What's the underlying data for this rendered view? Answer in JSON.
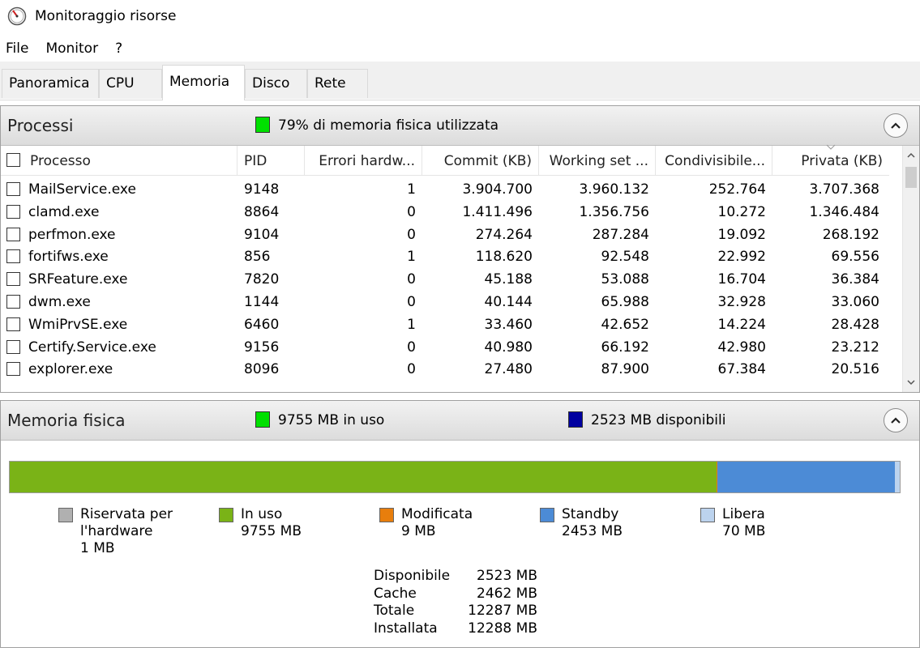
{
  "window": {
    "title": "Monitoraggio risorse"
  },
  "menu": [
    {
      "label": "File"
    },
    {
      "label": "Monitor"
    },
    {
      "label": "?"
    }
  ],
  "tabs": [
    {
      "label": "Panoramica",
      "active": false
    },
    {
      "label": "CPU",
      "active": false
    },
    {
      "label": "Memoria",
      "active": true
    },
    {
      "label": "Disco",
      "active": false
    },
    {
      "label": "Rete",
      "active": false
    }
  ],
  "processes": {
    "title": "Processi",
    "status_text": "79% di memoria fisica utilizzata",
    "status_color": "#00e000",
    "columns": [
      "Processo",
      "PID",
      "Errori hardw...",
      "Commit (KB)",
      "Working set ...",
      "Condivisibile...",
      "Privata (KB)"
    ],
    "rows": [
      [
        "MailService.exe",
        "9148",
        "1",
        "3.904.700",
        "3.960.132",
        "252.764",
        "3.707.368"
      ],
      [
        "clamd.exe",
        "8864",
        "0",
        "1.411.496",
        "1.356.756",
        "10.272",
        "1.346.484"
      ],
      [
        "perfmon.exe",
        "9104",
        "0",
        "274.264",
        "287.284",
        "19.092",
        "268.192"
      ],
      [
        "fortifws.exe",
        "856",
        "1",
        "118.620",
        "92.548",
        "22.992",
        "69.556"
      ],
      [
        "SRFeature.exe",
        "7820",
        "0",
        "45.188",
        "53.088",
        "16.704",
        "36.384"
      ],
      [
        "dwm.exe",
        "1144",
        "0",
        "40.144",
        "65.988",
        "32.928",
        "33.060"
      ],
      [
        "WmiPrvSE.exe",
        "6460",
        "1",
        "33.460",
        "42.652",
        "14.224",
        "28.428"
      ],
      [
        "Certify.Service.exe",
        "9156",
        "0",
        "40.980",
        "66.192",
        "42.980",
        "23.212"
      ],
      [
        "explorer.exe",
        "8096",
        "0",
        "27.480",
        "87.900",
        "67.384",
        "20.516"
      ]
    ]
  },
  "physical_memory": {
    "title": "Memoria fisica",
    "in_use_text": "9755 MB in uso",
    "in_use_color": "#00e000",
    "available_text": "2523 MB disponibili",
    "available_color": "#0000a0",
    "bar": [
      {
        "name": "reserved",
        "value": 1,
        "color": "#b0b0b0"
      },
      {
        "name": "in-use",
        "value": 9755,
        "color": "#7ab317"
      },
      {
        "name": "modified",
        "value": 9,
        "color": "#e87e0c"
      },
      {
        "name": "standby",
        "value": 2453,
        "color": "#4c8bd6"
      },
      {
        "name": "free",
        "value": 70,
        "color": "#bcd3ee"
      }
    ],
    "legend": [
      {
        "lines": [
          "Riservata per",
          "l'hardware",
          "1 MB"
        ],
        "color": "#b0b0b0"
      },
      {
        "lines": [
          "In uso",
          "9755 MB"
        ],
        "color": "#7ab317"
      },
      {
        "lines": [
          "Modificata",
          "9 MB"
        ],
        "color": "#e87e0c"
      },
      {
        "lines": [
          "Standby",
          "2453 MB"
        ],
        "color": "#4c8bd6"
      },
      {
        "lines": [
          "Libera",
          "70 MB"
        ],
        "color": "#bcd3ee"
      }
    ],
    "summary": [
      {
        "label": "Disponibile",
        "value": "2523 MB"
      },
      {
        "label": "Cache",
        "value": "2462 MB"
      },
      {
        "label": "Totale",
        "value": "12287 MB"
      },
      {
        "label": "Installata",
        "value": "12288 MB"
      }
    ]
  }
}
